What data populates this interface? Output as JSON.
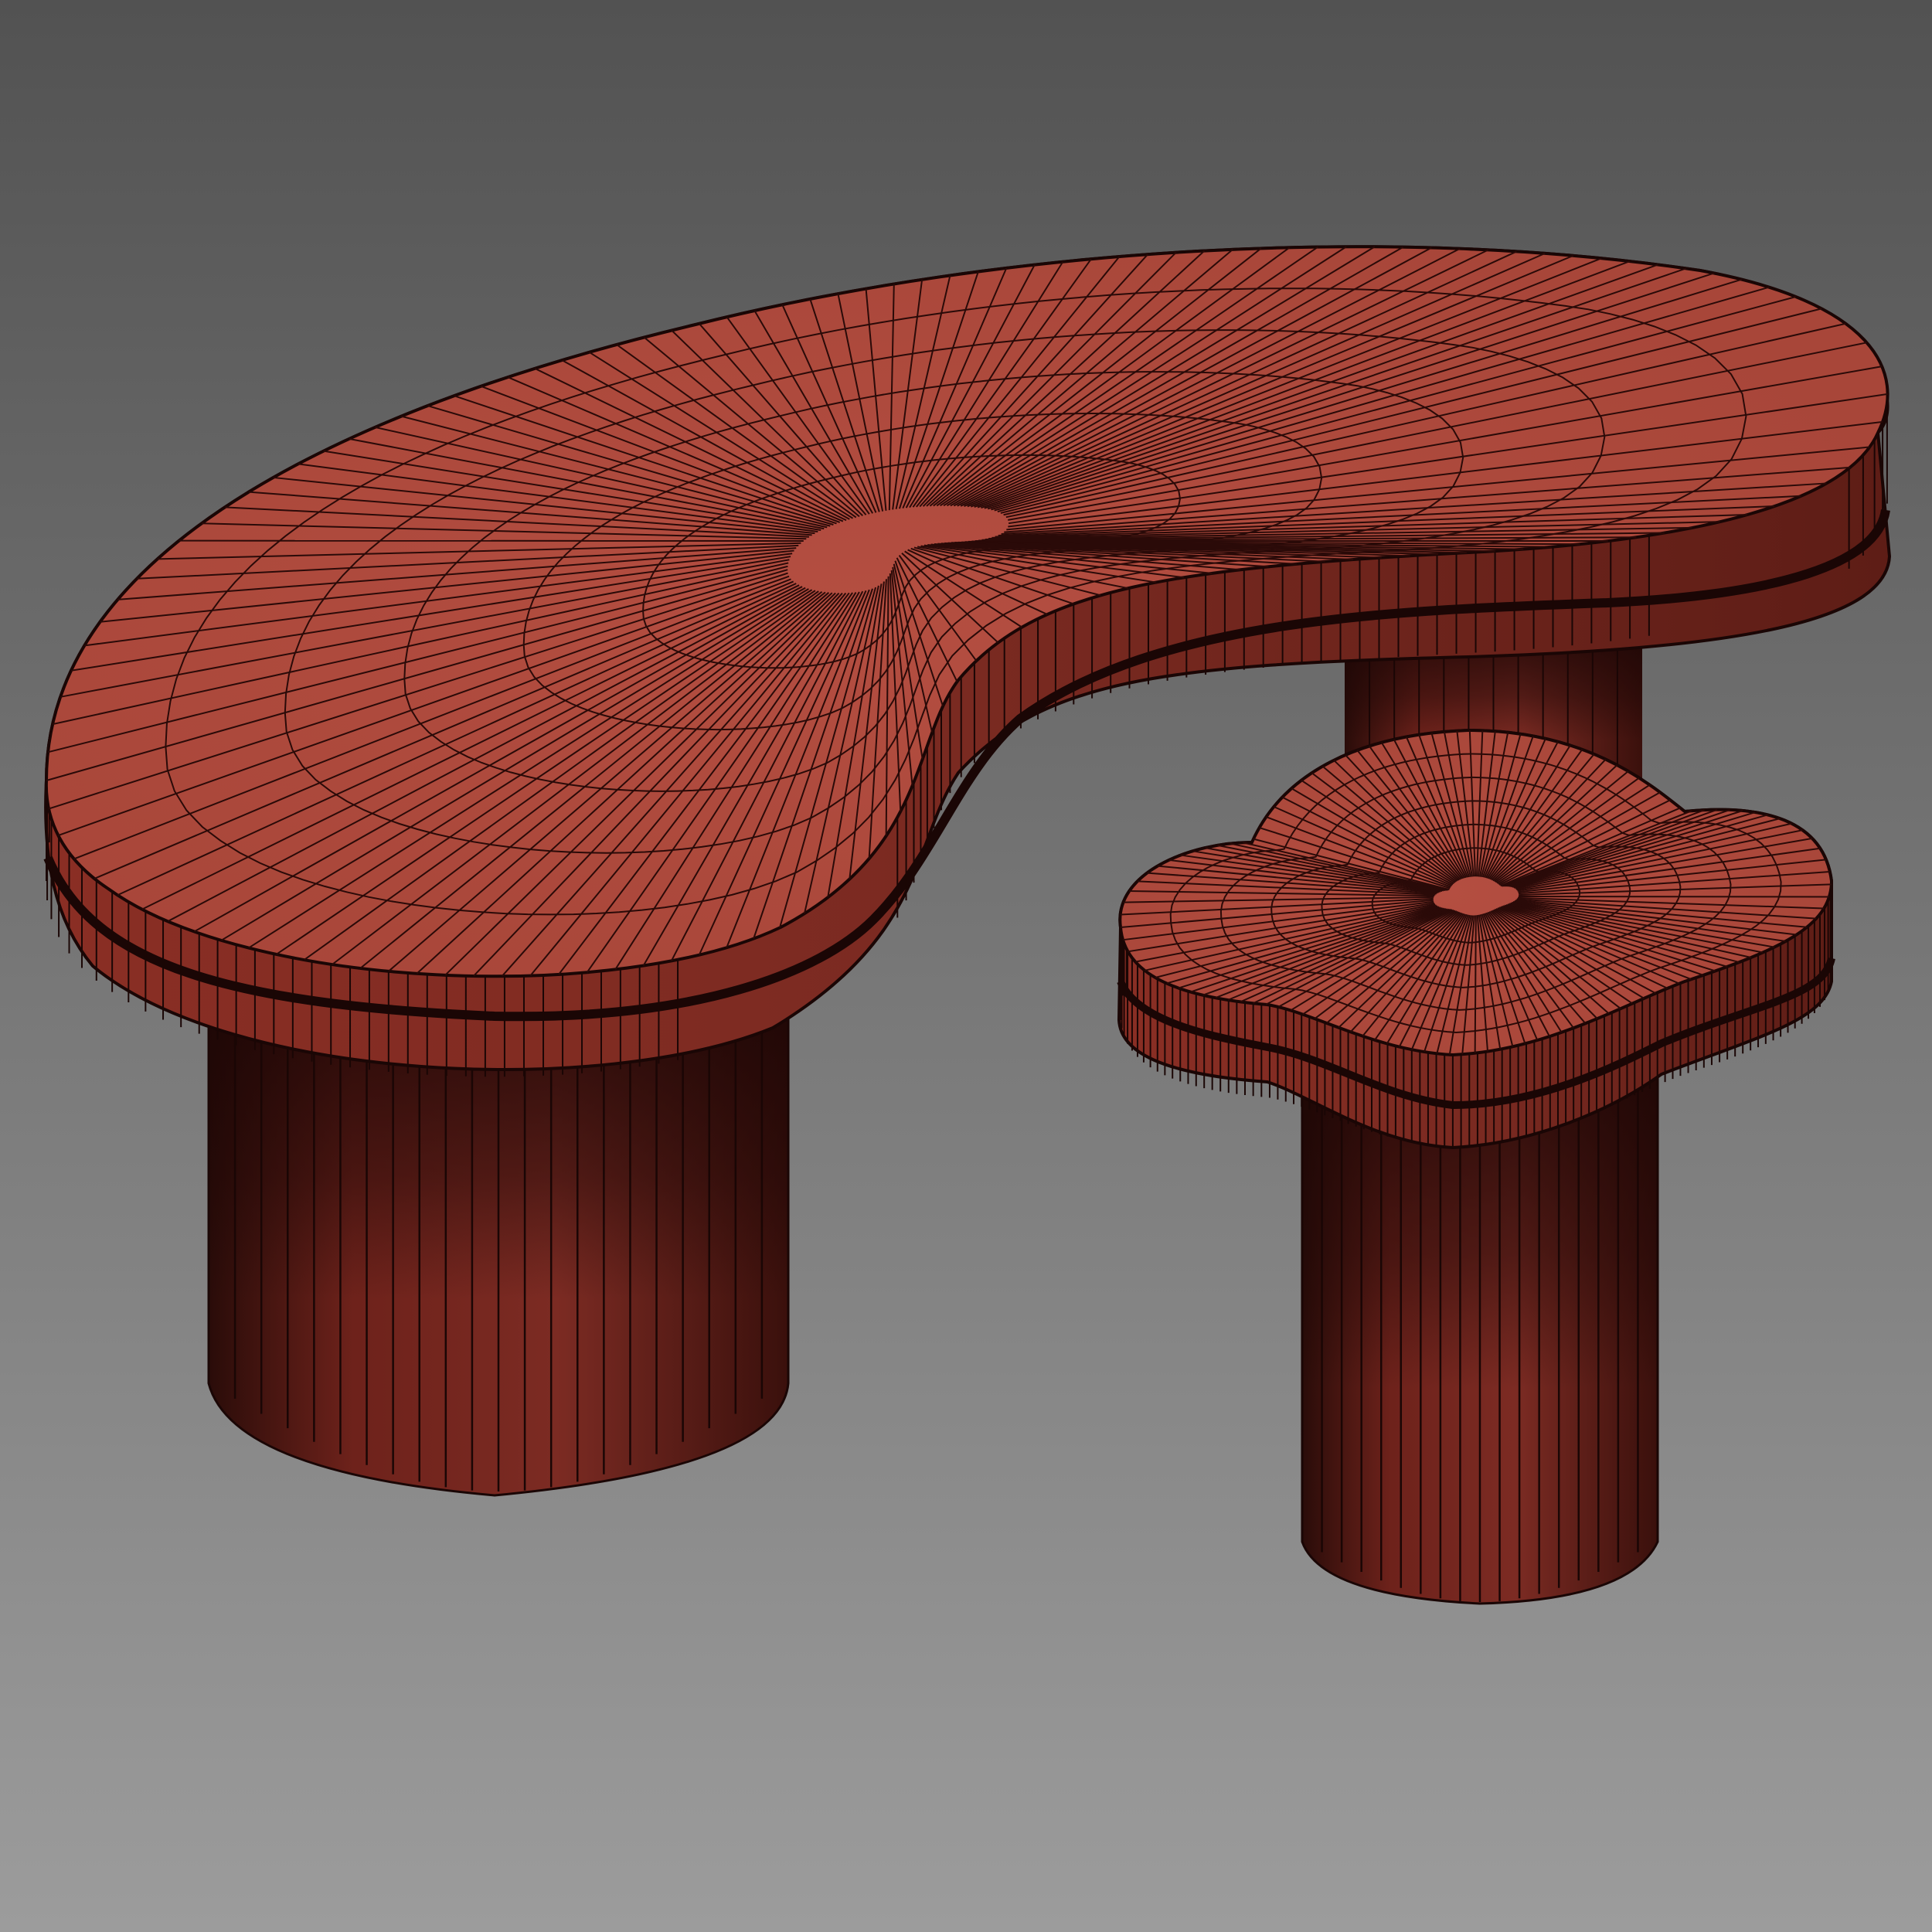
{
  "viewport": {
    "background_top": "#525252",
    "background_bottom": "#9c9c9c",
    "shading": "wireframe-on-shaded"
  },
  "scene": {
    "objects": [
      {
        "id": "kidney-coffee-table",
        "parts": [
          "table-top",
          "table-pedestal"
        ]
      },
      {
        "id": "cloud-side-table",
        "parts": [
          "side-table-top",
          "side-table-pedestal"
        ]
      }
    ]
  },
  "material": {
    "top_color": "#b04c40",
    "edge_color": "#7a2a20",
    "pedestal_light": "#7a2820",
    "pedestal_dark": "#2e0e0a",
    "wire_color": "#2a0a08"
  }
}
